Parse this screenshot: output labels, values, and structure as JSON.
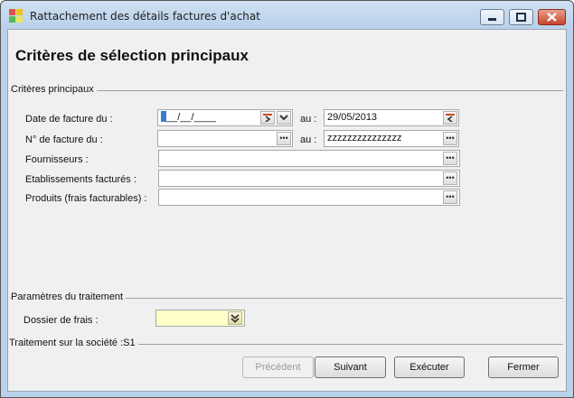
{
  "window": {
    "title": "Rattachement des détails factures d'achat",
    "icon": "app-icon",
    "controls": [
      "minimize-icon",
      "maximize-icon",
      "close-icon"
    ]
  },
  "page": {
    "heading": "Critères de sélection principaux"
  },
  "criteria_group": {
    "label": "Critères principaux",
    "date": {
      "label": "Date de facture du :",
      "from_value": "__/__/____",
      "to_label": "au :",
      "to_value": "29/05/2013"
    },
    "number": {
      "label": "N° de facture du :",
      "from_value": "",
      "to_label": "au :",
      "to_value": "zzzzzzzzzzzzzzz"
    },
    "suppliers": {
      "label": "Fournisseurs :",
      "value": ""
    },
    "establishments": {
      "label": "Etablissements facturés :",
      "value": ""
    },
    "products": {
      "label": "Produits (frais facturables) :",
      "value": ""
    },
    "ellipsis": "•••"
  },
  "processing_group": {
    "label": "Paramètres du traitement",
    "folder": {
      "label": "Dossier de frais :",
      "value": ""
    }
  },
  "company_group": {
    "label": "Traitement sur la société :S1"
  },
  "buttons": {
    "previous": "Précédent",
    "next": "Suivant",
    "execute": "Exécuter",
    "close": "Fermer"
  },
  "colors": {
    "window_frame": "#b9d1ea",
    "client_bg": "#f0f0f0",
    "required_field": "#ffffc8",
    "close_button": "#c8432b"
  }
}
